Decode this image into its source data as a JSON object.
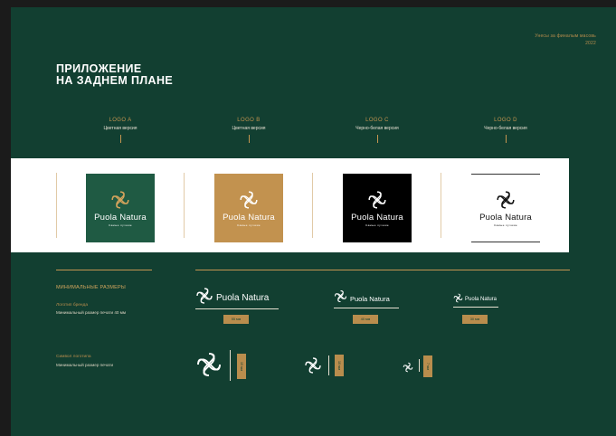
{
  "corner": {
    "line1": "Унесы за финалым масовь",
    "line2": "2022"
  },
  "title": {
    "line1": "ПРИЛОЖЕНИЕ",
    "line2": "НА ЗАДНЕМ ПЛАНЕ"
  },
  "columns": [
    {
      "name": "LOGO A",
      "sub": "Цветная версия"
    },
    {
      "name": "LOGO B",
      "sub": "Цветная версия"
    },
    {
      "name": "LOGO C",
      "sub": "Черно-белая версия"
    },
    {
      "name": "LOGO D",
      "sub": "Черно-белая версия"
    }
  ],
  "brand": {
    "wordmark": "Puola Natura",
    "tagline": "Самые лучшие"
  },
  "tiles": [
    {
      "bg": "#1f5a43",
      "fg": "#d5a45c",
      "text": "#ffffff"
    },
    {
      "bg": "#c2924f",
      "fg": "#ffffff",
      "text": "#ffffff"
    },
    {
      "bg": "#000000",
      "fg": "#ffffff",
      "text": "#ffffff"
    },
    {
      "bg": "#ffffff",
      "fg": "#111111",
      "text": "#111111"
    }
  ],
  "min_sizes": {
    "heading": "МИНИМАЛЬНЫЕ РАЗМЕРЫ",
    "logo_label": "Логотип бренда",
    "logo_desc": "Минимальный размер печати 40 мм",
    "symbol_label": "Символ логотипа",
    "symbol_desc": "Минимальный размер печати",
    "logo_badges": [
      "55 мм",
      "40 мм",
      "30 мм"
    ],
    "symbol_badges": [
      "15 мм",
      "10 мм",
      "7 мм"
    ]
  },
  "colors": {
    "slide_bg": "#123f31",
    "accent": "#c49550",
    "white": "#ffffff"
  }
}
